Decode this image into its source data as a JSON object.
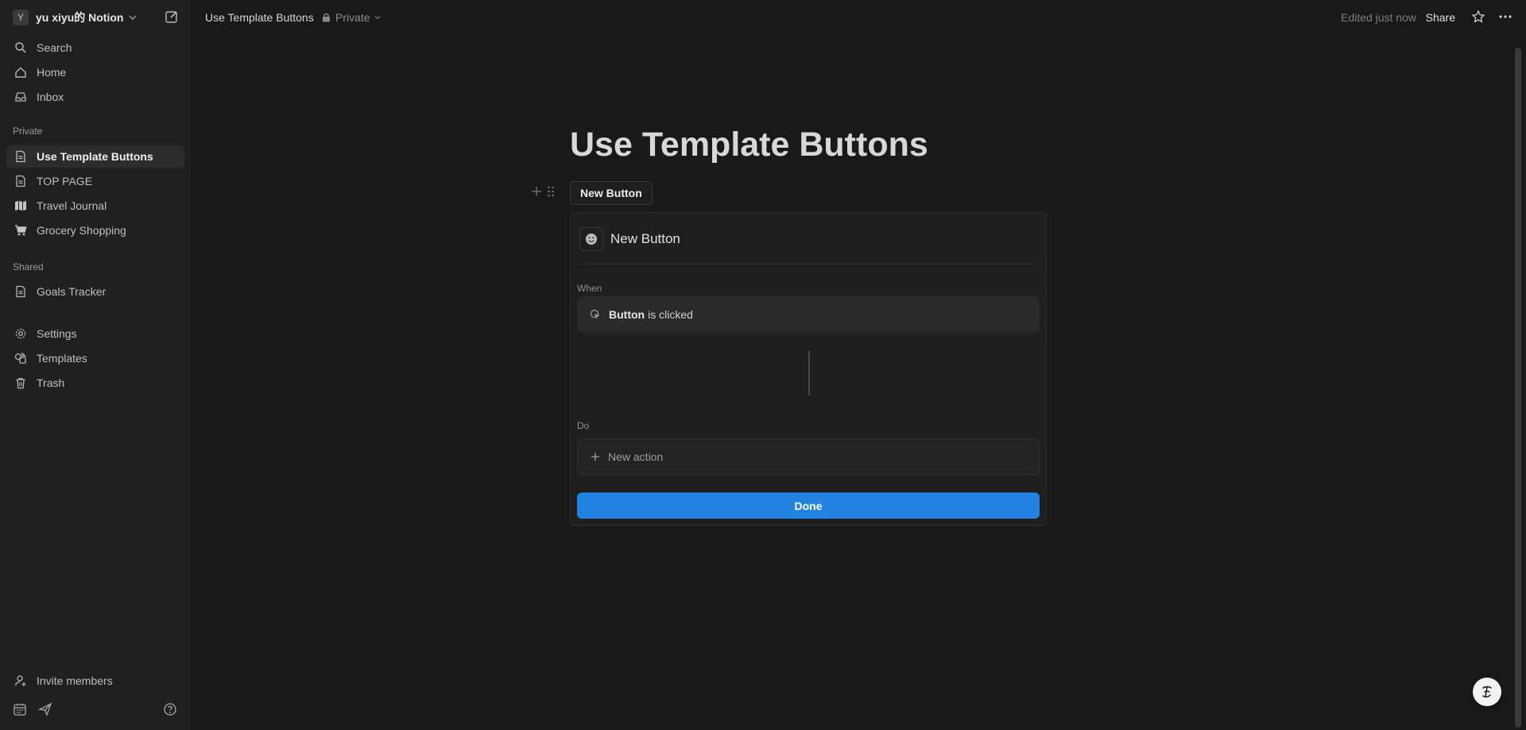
{
  "workspace": {
    "avatar_letter": "Y",
    "name": "yu xiyu的 Notion"
  },
  "sidebar": {
    "top_items": [
      {
        "label": "Search",
        "icon": "search-icon"
      },
      {
        "label": "Home",
        "icon": "home-icon"
      },
      {
        "label": "Inbox",
        "icon": "inbox-icon"
      }
    ],
    "private_label": "Private",
    "private_items": [
      {
        "label": "Use Template Buttons",
        "icon": "page-icon",
        "active": true
      },
      {
        "label": "TOP PAGE",
        "icon": "page-icon"
      },
      {
        "label": "Travel Journal",
        "icon": "map-icon"
      },
      {
        "label": "Grocery Shopping",
        "icon": "cart-icon"
      }
    ],
    "shared_label": "Shared",
    "shared_items": [
      {
        "label": "Goals Tracker",
        "icon": "page-icon"
      }
    ],
    "utility_items": [
      {
        "label": "Settings",
        "icon": "gear-icon"
      },
      {
        "label": "Templates",
        "icon": "templates-icon"
      },
      {
        "label": "Trash",
        "icon": "trash-icon"
      }
    ],
    "invite_label": "Invite members"
  },
  "topbar": {
    "breadcrumb": "Use Template Buttons",
    "privacy": "Private",
    "edited": "Edited just now",
    "share": "Share"
  },
  "page": {
    "title": "Use Template Buttons",
    "button_label": "New Button"
  },
  "panel": {
    "name": "New Button",
    "when_label": "When",
    "trigger_bold": "Button",
    "trigger_rest": "is clicked",
    "do_label": "Do",
    "new_action": "New action",
    "done": "Done"
  },
  "colors": {
    "accent": "#2383e2",
    "background": "#191919",
    "sidebar": "#202020"
  }
}
